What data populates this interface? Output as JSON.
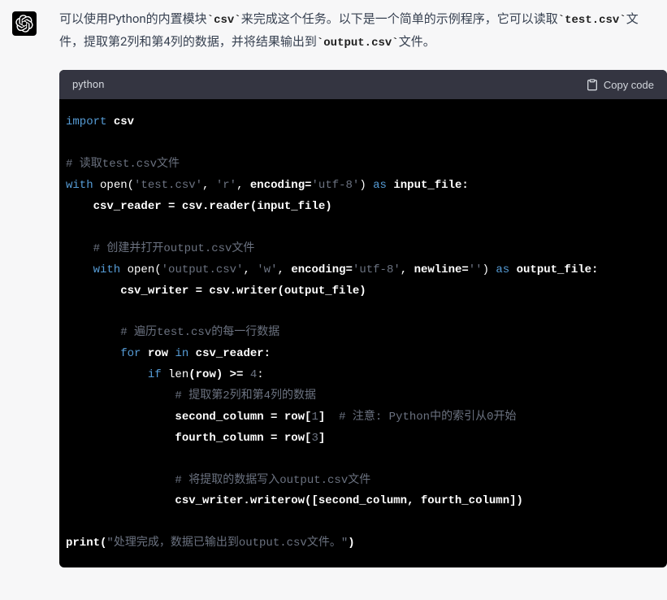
{
  "intro": {
    "part1": "可以使用Python的内置模块",
    "code1": "`csv`",
    "part2": "来完成这个任务。以下是一个简单的示例程序，它可以读取",
    "code2": "`test.csv`",
    "part3": "文件，提取第2列和第4列的数据，并将结果输出到",
    "code3": "`output.csv`",
    "part4": "文件。"
  },
  "codeblock": {
    "language": "python",
    "copy_label": "Copy code"
  },
  "code": {
    "l1_import": "import",
    "l1_csv": "csv",
    "l3_comment": "# 读取test.csv文件",
    "l4_with": "with",
    "l4_open": "open(",
    "l4_str": "'test.csv'",
    "l4_comma": ", ",
    "l4_r": "'r'",
    "l4_enc_kw": "encoding=",
    "l4_enc_val": "'utf-8'",
    "l4_paren": ")",
    "l4_as": "as",
    "l4_var": "input_file:",
    "l5": "    csv_reader = csv.reader(input_file)",
    "l7_comment": "    # 创建并打开output.csv文件",
    "l8_with": "    with",
    "l8_open": "open(",
    "l8_str": "'output.csv'",
    "l8_w": "'w'",
    "l8_enc_kw": "encoding=",
    "l8_enc_val": "'utf-8'",
    "l8_newline_kw": "newline=",
    "l8_newline_val": "''",
    "l8_as": "as",
    "l8_var": "output_file:",
    "l9": "        csv_writer = csv.writer(output_file)",
    "l11_comment": "        # 遍历test.csv的每一行数据",
    "l12_for": "        for",
    "l12_row": "row",
    "l12_in": "in",
    "l12_reader": "csv_reader:",
    "l13_if": "            if",
    "l13_len": "len",
    "l13_row": "(row) >= ",
    "l13_4": "4",
    "l13_colon": ":",
    "l14_comment": "                # 提取第2列和第4列的数据",
    "l15_sec": "                second_column = row[",
    "l15_1": "1",
    "l15_br": "]",
    "l15_comment": "  # 注意: Python中的索引从0开始",
    "l16_fourth": "                fourth_column = row[",
    "l16_3": "3",
    "l16_br": "]",
    "l18_comment": "                # 将提取的数据写入output.csv文件",
    "l19": "                csv_writer.writerow([second_column, fourth_column])",
    "l21_print": "print(",
    "l21_str": "\"处理完成，数据已输出到output.csv文件。\"",
    "l21_close": ")"
  }
}
